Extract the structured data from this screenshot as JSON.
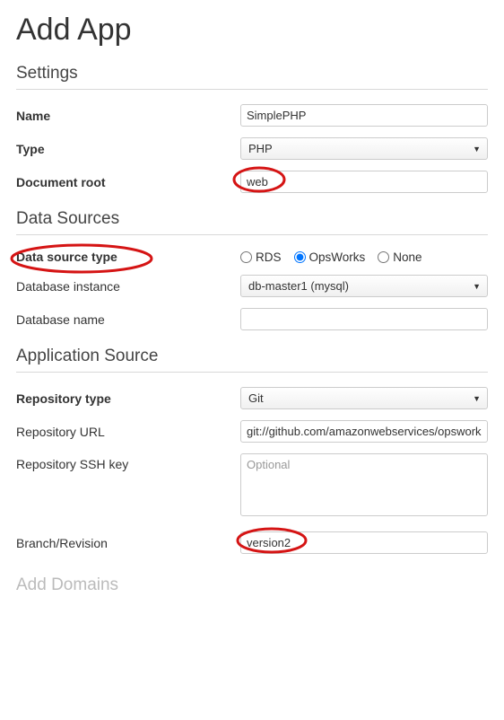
{
  "title": "Add App",
  "settings": {
    "heading": "Settings",
    "name_label": "Name",
    "name_value": "SimplePHP",
    "type_label": "Type",
    "type_value": "PHP",
    "docroot_label": "Document root",
    "docroot_value": "web"
  },
  "data_sources": {
    "heading": "Data Sources",
    "source_type_label": "Data source type",
    "options": {
      "rds": "RDS",
      "opsworks": "OpsWorks",
      "none": "None"
    },
    "selected": "opsworks",
    "db_instance_label": "Database instance",
    "db_instance_value": "db-master1 (mysql)",
    "db_name_label": "Database name",
    "db_name_value": ""
  },
  "app_source": {
    "heading": "Application Source",
    "repo_type_label": "Repository type",
    "repo_type_value": "Git",
    "repo_url_label": "Repository URL",
    "repo_url_value": "git://github.com/amazonwebservices/opsworks",
    "ssh_key_label": "Repository SSH key",
    "ssh_key_placeholder": "Optional",
    "branch_label": "Branch/Revision",
    "branch_value": "version2"
  },
  "domains": {
    "heading": "Add Domains"
  }
}
